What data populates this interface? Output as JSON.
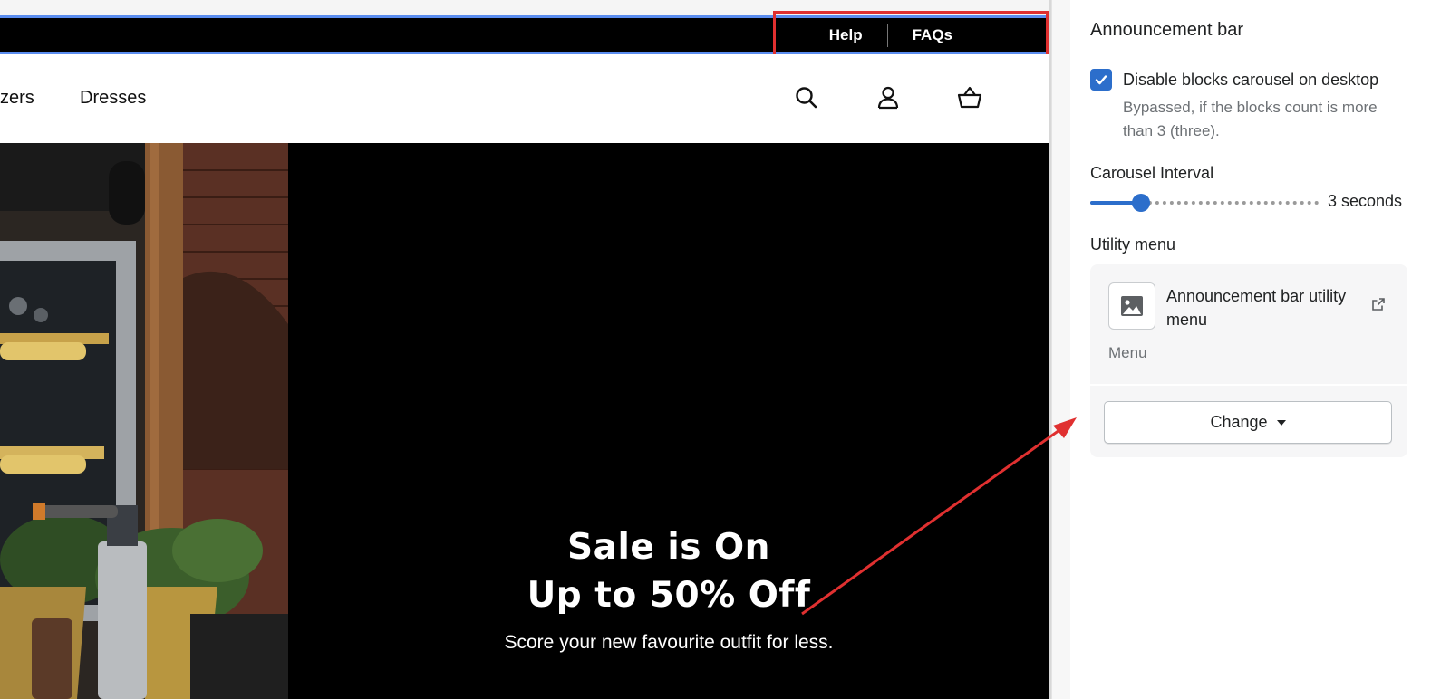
{
  "announcement_bar": {
    "links": [
      "Help",
      "FAQs"
    ]
  },
  "header": {
    "nav": [
      "zers",
      "Dresses"
    ],
    "icons": [
      "search-icon",
      "account-icon",
      "cart-icon"
    ]
  },
  "hero": {
    "title_line1": "Sale is On",
    "title_line2": "Up to 50% Off",
    "subtitle": "Score your new favourite outfit for less."
  },
  "panel": {
    "title": "Announcement bar",
    "checkbox": {
      "label": "Disable blocks carousel on desktop",
      "checked": true,
      "help": "Bypassed, if the blocks count is more than 3 (three)."
    },
    "carousel_interval": {
      "label": "Carousel Interval",
      "value": 3,
      "min": 1,
      "max": 10,
      "value_text": "3 seconds"
    },
    "utility_menu": {
      "label": "Utility menu",
      "menu_name": "Announcement bar utility menu",
      "menu_type": "Menu",
      "change_label": "Change"
    }
  },
  "colors": {
    "accent": "#2c6ecb",
    "highlight": "#e03030",
    "bar_border": "#5b8def"
  }
}
